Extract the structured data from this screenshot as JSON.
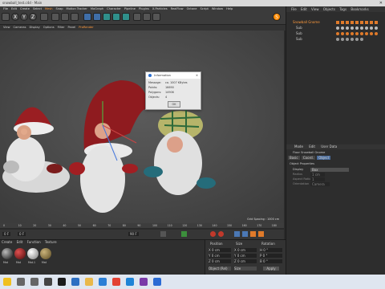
{
  "window": {
    "title": "snowball_test.c4d - Main"
  },
  "menu": [
    "File",
    "Edit",
    "Create",
    "Select",
    "Mesh",
    "Snap",
    "Motion Tracker",
    "MoGraph",
    "Character",
    "Pipeline",
    "Plugins",
    "X-Particles",
    "RealFlow",
    "Octane",
    "Script",
    "Window",
    "Help"
  ],
  "menu_highlight": "Mesh",
  "subtoolbar": [
    "View",
    "Cameras",
    "Display",
    "Options",
    "Filter",
    "Panel",
    "ProRender"
  ],
  "subtoolbar_highlight": "ProRender",
  "viewport": {
    "grid_spacing": "Grid Spacing : 1000 cm"
  },
  "dialog": {
    "title": "Information",
    "rows": [
      {
        "label": "Message:",
        "value": "ca. 1007 KBytes"
      },
      {
        "label": "Points:",
        "value": "16690"
      },
      {
        "label": "Polygons:",
        "value": "14906"
      },
      {
        "label": "Objects:",
        "value": "4"
      }
    ],
    "ok": "OK"
  },
  "timeline": {
    "ticks": [
      "0",
      "10",
      "20",
      "30",
      "40",
      "50",
      "60",
      "70",
      "80",
      "90",
      "100",
      "110",
      "120",
      "130",
      "140",
      "150",
      "160",
      "170",
      "180"
    ],
    "current_frame": "0 F",
    "end_frame": "90 F",
    "start_frame": "0 F"
  },
  "material_manager": {
    "menu": [
      "Create",
      "Edit",
      "Function",
      "Texture"
    ],
    "materials": [
      "Mat",
      "Mat",
      "Mat.1",
      "Mat"
    ]
  },
  "coord_manager": {
    "headers": [
      "Position",
      "Size",
      "Rotation"
    ],
    "rows": [
      {
        "p": "X  0 cm",
        "s": "X  0 cm",
        "r": "H  0 °"
      },
      {
        "p": "Y  0 cm",
        "s": "Y  0 cm",
        "r": "P  0 °"
      },
      {
        "p": "Z  0 cm",
        "s": "Z  0 cm",
        "r": "B  0 °"
      }
    ],
    "mode": "Object (Rel)",
    "size_mode": "Size",
    "apply": "Apply"
  },
  "object_manager": {
    "menu": [
      "File",
      "Edit",
      "View",
      "Objects",
      "Tags",
      "Bookmarks"
    ],
    "objects": [
      "Snowball Gnome",
      "Sub",
      "Sub",
      "Sub"
    ]
  },
  "attributes": {
    "menu": [
      "Mode",
      "Edit",
      "User Data"
    ],
    "object_name": "Floor Snowball Gnome",
    "tabs": [
      "Basic",
      "Coord.",
      "Object"
    ],
    "section": "Object Properties",
    "fields": [
      {
        "label": "Display",
        "value": "Box"
      },
      {
        "label": "Radius",
        "value": "1 cm"
      },
      {
        "label": "Aspect Ratio",
        "value": "1"
      },
      {
        "label": "Orientation",
        "value": "Camera"
      }
    ]
  },
  "colors": {
    "accent": "#ff9a3c",
    "viewport_bg": "#4a4a4a",
    "panel_bg": "#2d2d2d"
  },
  "taskbar_icons": [
    "start-icon",
    "search-icon",
    "task-view-icon",
    "close-icon",
    "cinema4d-icon",
    "photoshop-icon",
    "file-explorer-icon",
    "vscode-icon",
    "chrome-icon",
    "edge-icon",
    "aftereffects-icon",
    "windows-icon"
  ]
}
